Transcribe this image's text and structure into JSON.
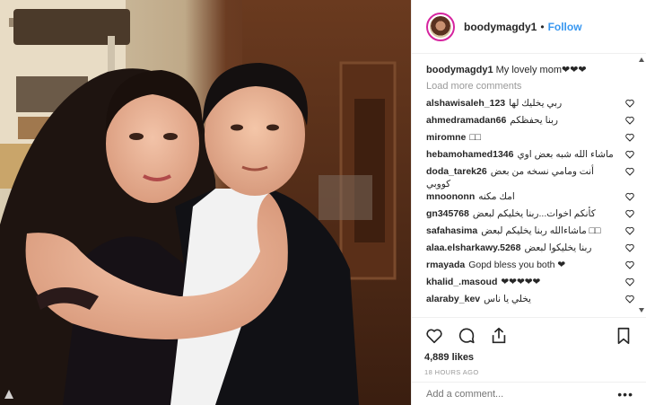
{
  "post": {
    "username": "boodymagdy1",
    "separator": "•",
    "follow_label": "Follow",
    "caption_user": "boodymagdy1",
    "caption_text": "My lovely mom❤❤❤",
    "load_more": "Load more comments",
    "likes": "4,889 likes",
    "time": "18 HOURS AGO",
    "add_comment_placeholder": "Add a comment...",
    "more_label": "•••"
  },
  "comments": [
    {
      "user": "alshawisaleh_123",
      "text": "ربي يخليك لها"
    },
    {
      "user": "ahmedramadan66",
      "text": "ربنا يحفظكم"
    },
    {
      "user": "miromne",
      "text": "□□"
    },
    {
      "user": "hebamohamed1346",
      "text": "ماشاء الله شبه بعض اوي"
    },
    {
      "user": "doda_tarek26",
      "text": "أنت ومامي نسخه من بعض كووبي"
    },
    {
      "user": "mnoononn",
      "text": "امك مكنه"
    },
    {
      "user": "gn345768",
      "text": "كأنكم اخوات...ربنا يخليكم لبعض"
    },
    {
      "user": "safahasima",
      "text": "ماشاءالله ربنا يخليكم لبعض □□"
    },
    {
      "user": "alaa.elsharkawy.5268",
      "text": "ربنا يخليكوا لبعض"
    },
    {
      "user": "rmayada",
      "text": "Gopd bless you both ❤"
    },
    {
      "user": "khalid_.masoud",
      "text": "❤❤❤❤❤"
    },
    {
      "user": "alaraby_kev",
      "text": "يخلي يا ناس"
    }
  ],
  "colors": {
    "accent": "#3897f0",
    "text": "#262626",
    "muted": "#999999",
    "story_ring": "#d6249f"
  },
  "icons": [
    "heart-icon",
    "comment-icon",
    "share-icon",
    "bookmark-icon"
  ]
}
